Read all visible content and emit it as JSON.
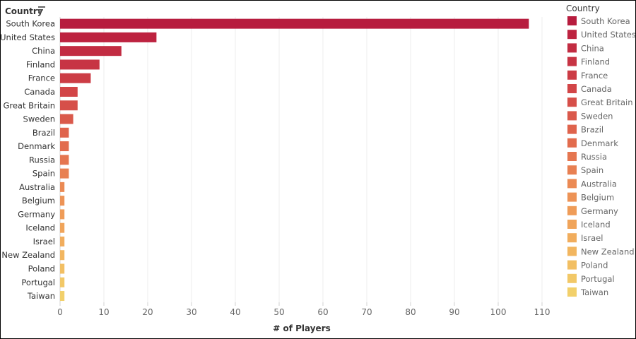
{
  "chart_data": {
    "type": "bar",
    "orientation": "horizontal",
    "title": "",
    "ylabel": "Country",
    "xlabel": "# of Players",
    "legend_title": "Country",
    "legend_position": "right",
    "xlim": [
      0,
      110
    ],
    "xticks": [
      0,
      10,
      20,
      30,
      40,
      50,
      60,
      70,
      80,
      90,
      100,
      110
    ],
    "grid": true,
    "categories": [
      "South Korea",
      "United States",
      "China",
      "Finland",
      "France",
      "Canada",
      "Great Britain",
      "Sweden",
      "Brazil",
      "Denmark",
      "Russia",
      "Spain",
      "Australia",
      "Belgium",
      "Germany",
      "Iceland",
      "Israel",
      "New Zealand",
      "Poland",
      "Portugal",
      "Taiwan"
    ],
    "values": [
      107,
      22,
      14,
      9,
      7,
      4,
      4,
      3,
      2,
      2,
      2,
      2,
      1,
      1,
      1,
      1,
      1,
      1,
      1,
      1,
      1
    ],
    "colors": [
      "#b71c3e",
      "#bd2340",
      "#c22c42",
      "#c73444",
      "#cc3c45",
      "#d24547",
      "#d64f49",
      "#da594b",
      "#df634c",
      "#e26c4e",
      "#e57650",
      "#e88052",
      "#eb8a54",
      "#ed9356",
      "#ef9c58",
      "#f0a45a",
      "#f1ad5d",
      "#f2b660",
      "#f2bf63",
      "#f2c867",
      "#f2d06b"
    ]
  }
}
